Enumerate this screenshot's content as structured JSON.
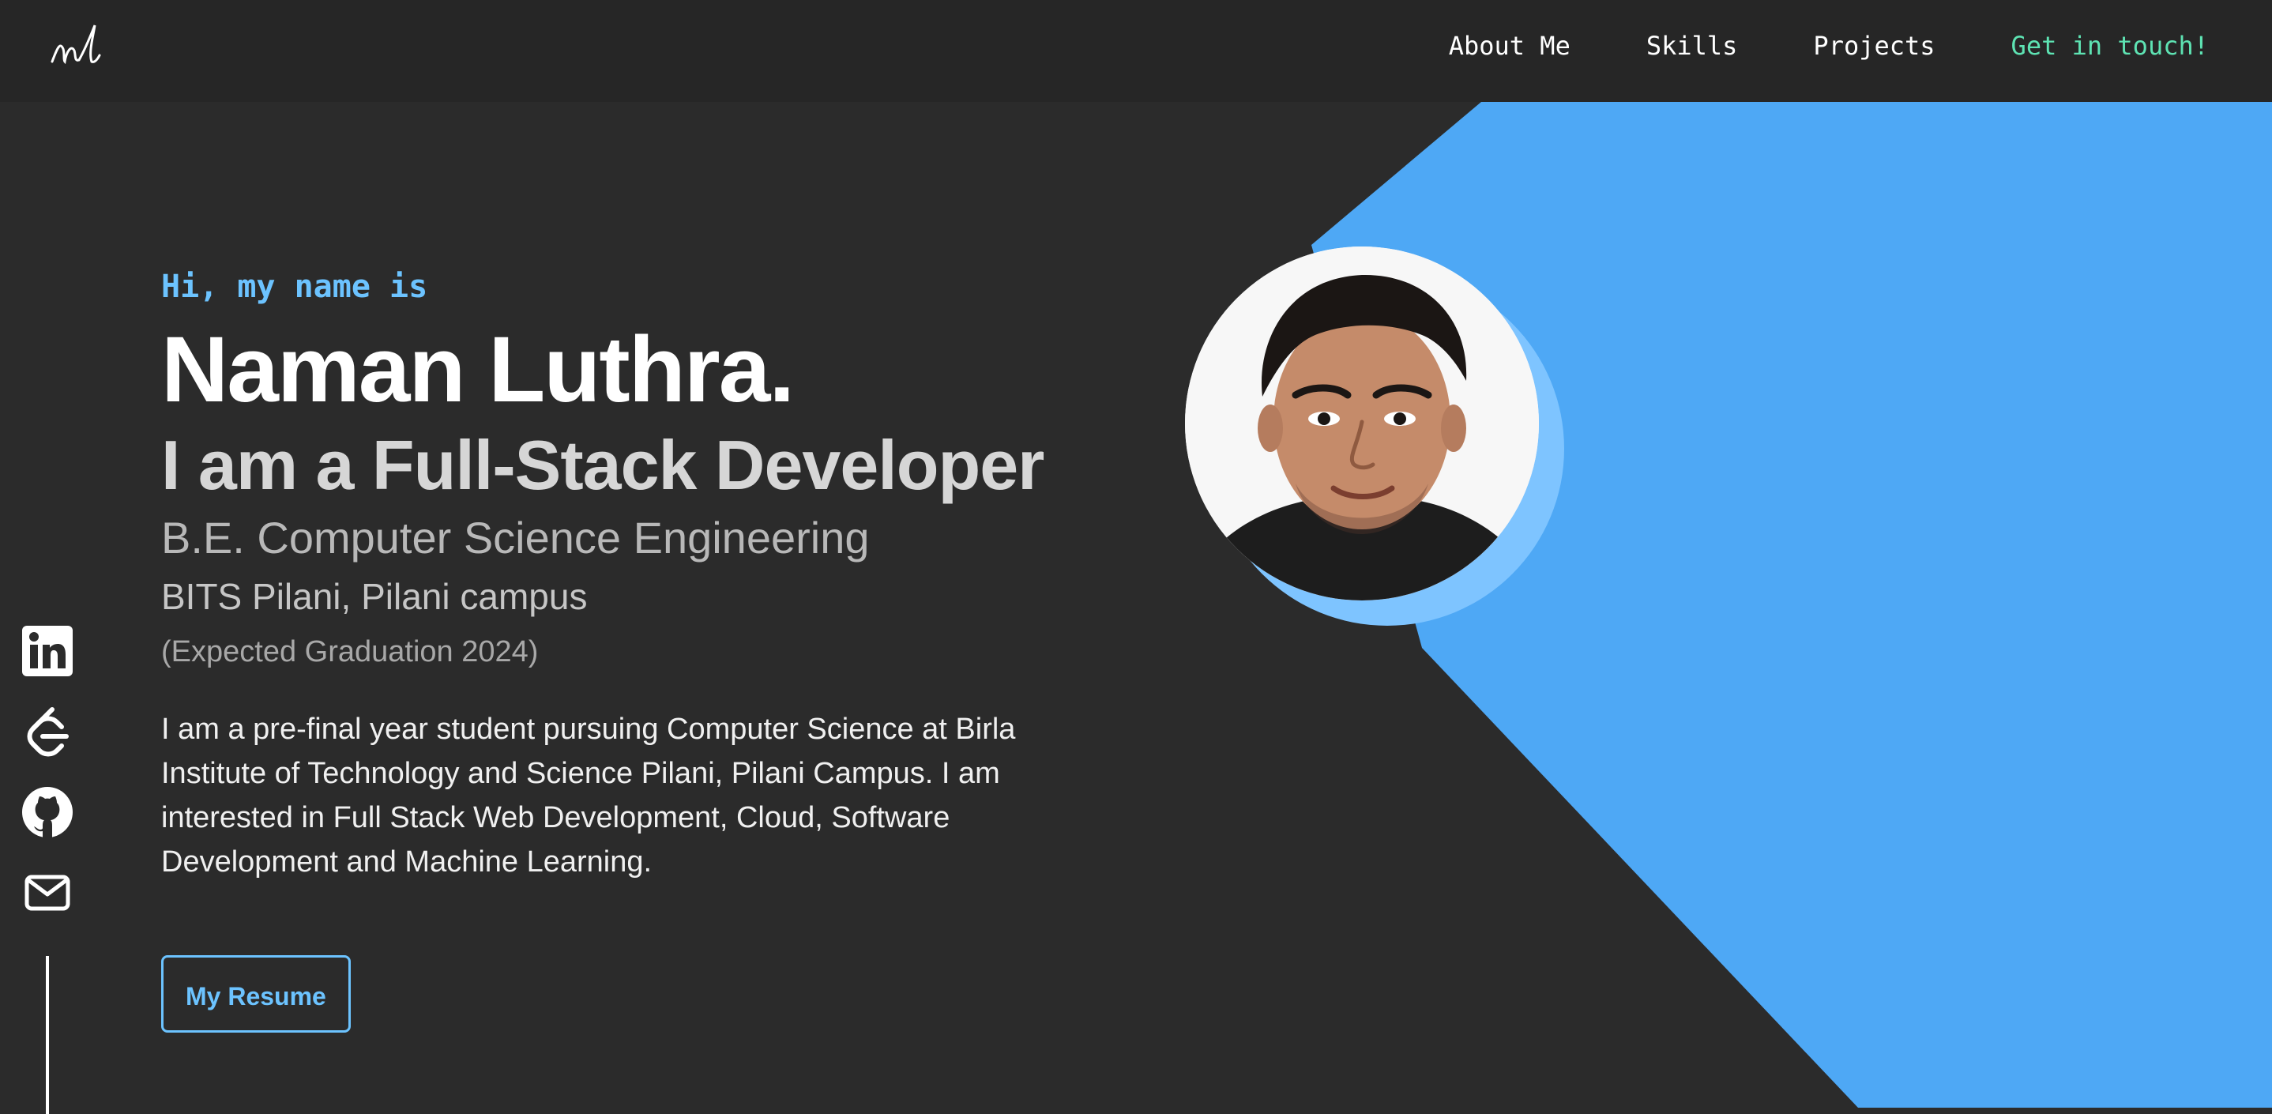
{
  "nav": {
    "logo_text": "nl",
    "links": [
      "About Me",
      "Skills",
      "Projects",
      "Get in touch!"
    ]
  },
  "hero": {
    "greeting": "Hi, my name is",
    "name": "Naman Luthra.",
    "role": "I am a Full-Stack Developer",
    "degree": "B.E. Computer Science Engineering",
    "college": "BITS Pilani, Pilani campus",
    "graduation": "(Expected Graduation 2024)",
    "bio": "I am a pre-final year student pursuing Computer Science at Birla Institute of Technology and Science Pilani, Pilani Campus. I am interested in Full Stack Web Development, Cloud, Software Development and Machine Learning.",
    "resume_label": "My Resume"
  },
  "social": {
    "icons": [
      "linkedin-icon",
      "leetcode-icon",
      "github-icon",
      "mail-icon"
    ]
  },
  "colors": {
    "background": "#2b2b2b",
    "navbar": "#262626",
    "accent_blue": "#4ea8f5",
    "accent_light_blue": "#6cc3ff",
    "accent_green": "#5ee3b3"
  }
}
